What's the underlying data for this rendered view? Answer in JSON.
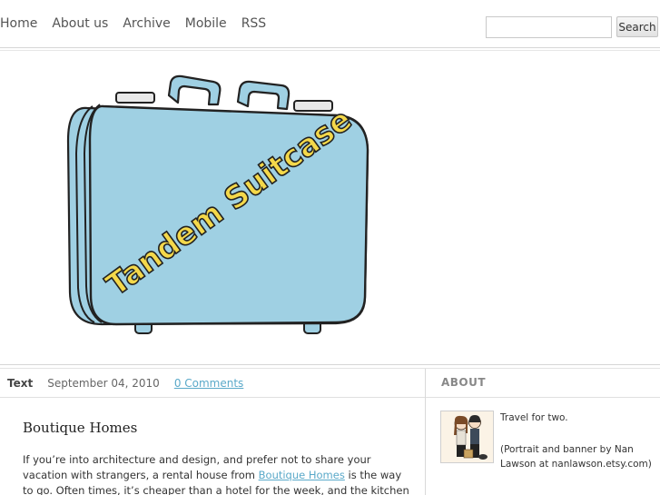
{
  "nav": {
    "items": [
      {
        "label": "Home"
      },
      {
        "label": "About us"
      },
      {
        "label": "Archive"
      },
      {
        "label": "Mobile"
      },
      {
        "label": "RSS"
      }
    ]
  },
  "search": {
    "value": "",
    "placeholder": "",
    "button_label": "Search"
  },
  "banner": {
    "logo_text": "Tandem Suitcase",
    "suitcase_color": "#9fd0e3",
    "logo_text_color": "#f4d84a"
  },
  "post": {
    "type": "Text",
    "date": "September 04, 2010",
    "comments": "0 Comments",
    "title": "Boutique Homes",
    "body_before": "If you’re into architecture and design, and prefer not to share your vacation with strangers, a rental house from ",
    "body_link": "Boutique Homes",
    "body_after": "  is the way to go. Often times, it’s cheaper than a hotel for the week, and the kitchen means you can save some"
  },
  "sidebar": {
    "title": "ABOUT",
    "line1": "Travel for two.",
    "line2": "(Portrait and banner by Nan Lawson at nanlawson.etsy.com)"
  },
  "colors": {
    "link": "#5aa9c9",
    "accent_text": "#888888"
  }
}
